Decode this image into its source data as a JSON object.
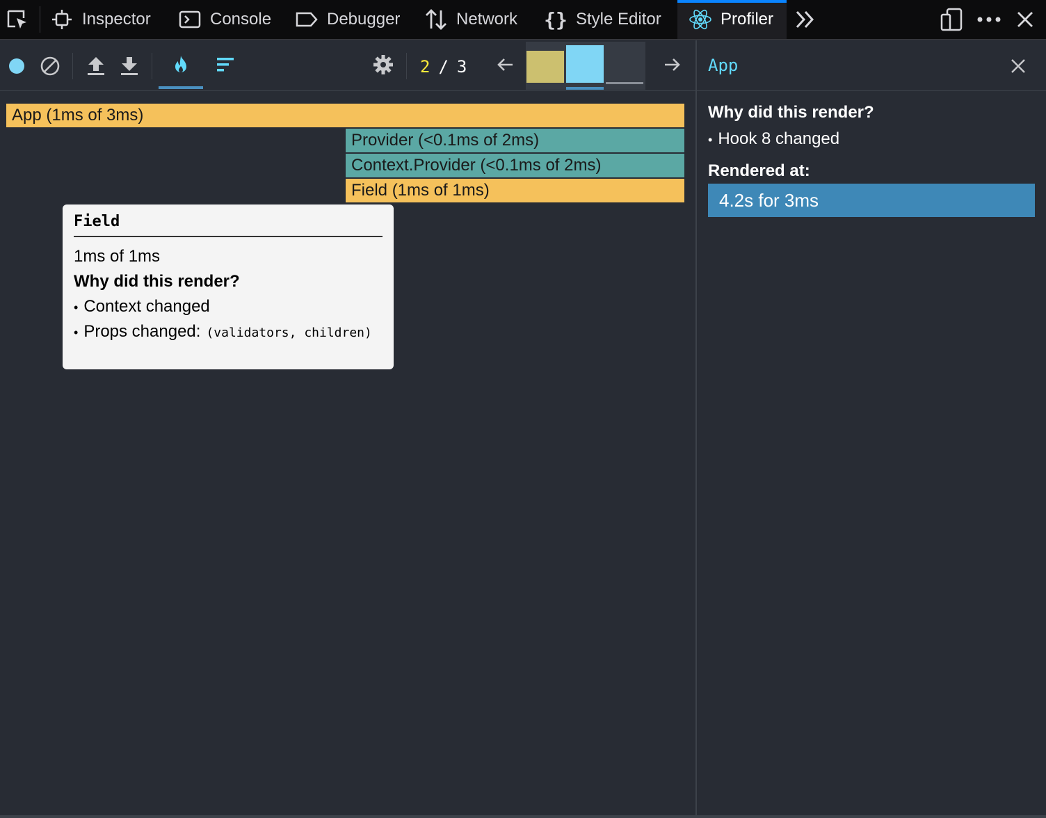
{
  "devtools": {
    "tabs": [
      {
        "label": "Inspector",
        "icon": "inspector-icon"
      },
      {
        "label": "Console",
        "icon": "console-icon"
      },
      {
        "label": "Debugger",
        "icon": "debugger-icon"
      },
      {
        "label": "Network",
        "icon": "network-icon"
      },
      {
        "label": "Style Editor",
        "icon": "style-editor-icon"
      },
      {
        "label": "Profiler",
        "icon": "react-icon",
        "active": true
      }
    ],
    "accent_color": "#0a84ff"
  },
  "toolbar": {
    "commit_current": "2",
    "commit_separator": "/",
    "commit_total": "3",
    "commit_bar_heights": [
      0.85,
      1.0,
      0.05
    ],
    "colors": {
      "record": "#80d6f5",
      "selected_commit": "#80d6f5"
    }
  },
  "flamegraph": {
    "frames": [
      {
        "label": "App (1ms of 3ms)",
        "color": "#f5c15b"
      },
      {
        "label": "Provider (<0.1ms of 2ms)",
        "color": "#5ba8a4"
      },
      {
        "label": "Context.Provider (<0.1ms of 2ms)",
        "color": "#5ba8a4"
      },
      {
        "label": "Field (1ms of 1ms)",
        "color": "#f5c15b"
      }
    ]
  },
  "tooltip": {
    "title": "Field",
    "duration": "1ms of 1ms",
    "why_heading": "Why did this render?",
    "reasons": [
      {
        "bullet": "•",
        "text": "Context changed",
        "detail": ""
      },
      {
        "bullet": "•",
        "text": "Props changed:",
        "detail": "(validators, children)"
      }
    ]
  },
  "sidebar": {
    "title": "App",
    "why_heading": "Why did this render?",
    "reason": "Hook 8 changed",
    "reason_bullet": "•",
    "rendered_at_heading": "Rendered at:",
    "renders": [
      "4.2s for 3ms"
    ],
    "title_color": "#61dafb",
    "selected_color": "#3e88b7"
  }
}
